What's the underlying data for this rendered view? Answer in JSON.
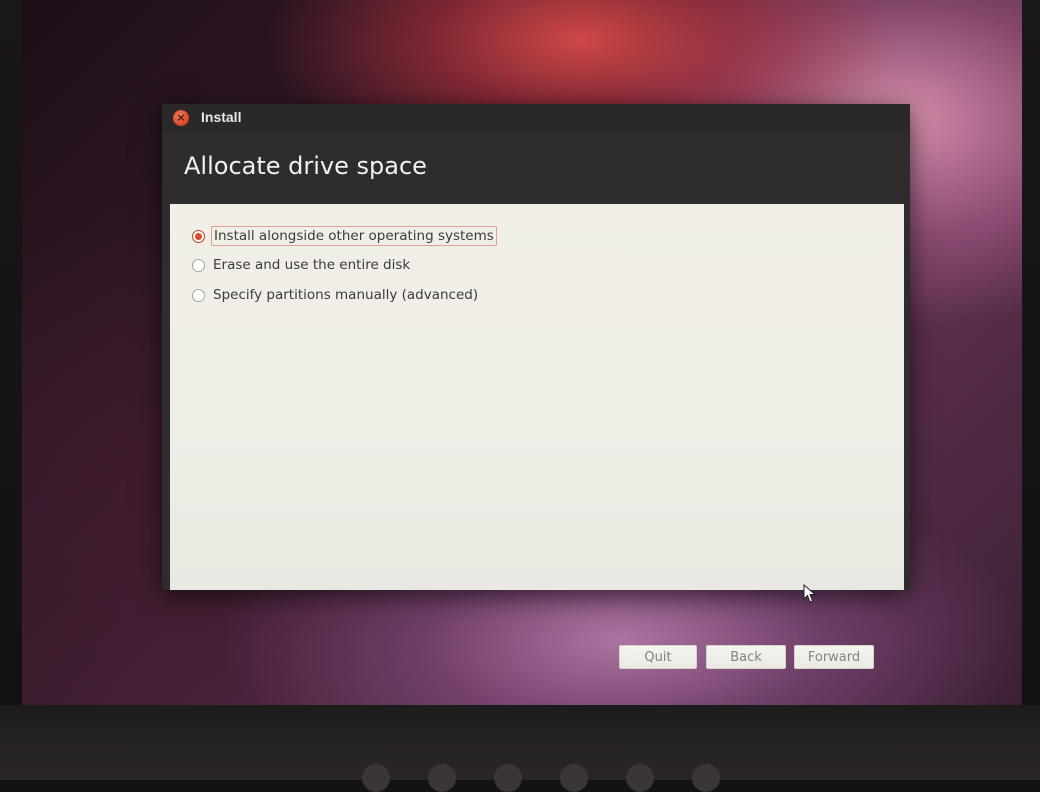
{
  "window": {
    "title": "Install",
    "close_icon": "close-icon"
  },
  "page": {
    "title": "Allocate drive space"
  },
  "options": [
    {
      "label": "Install alongside other operating systems",
      "selected": true
    },
    {
      "label": "Erase and use the entire disk",
      "selected": false
    },
    {
      "label": "Specify partitions manually (advanced)",
      "selected": false
    }
  ],
  "buttons": {
    "quit": "Quit",
    "back": "Back",
    "forward": "Forward"
  },
  "colors": {
    "accent": "#df4a2b",
    "titlebar": "#2f2c2e",
    "content_bg": "#f1efe7"
  },
  "icons": {
    "cursor": "mouse-pointer-icon"
  }
}
